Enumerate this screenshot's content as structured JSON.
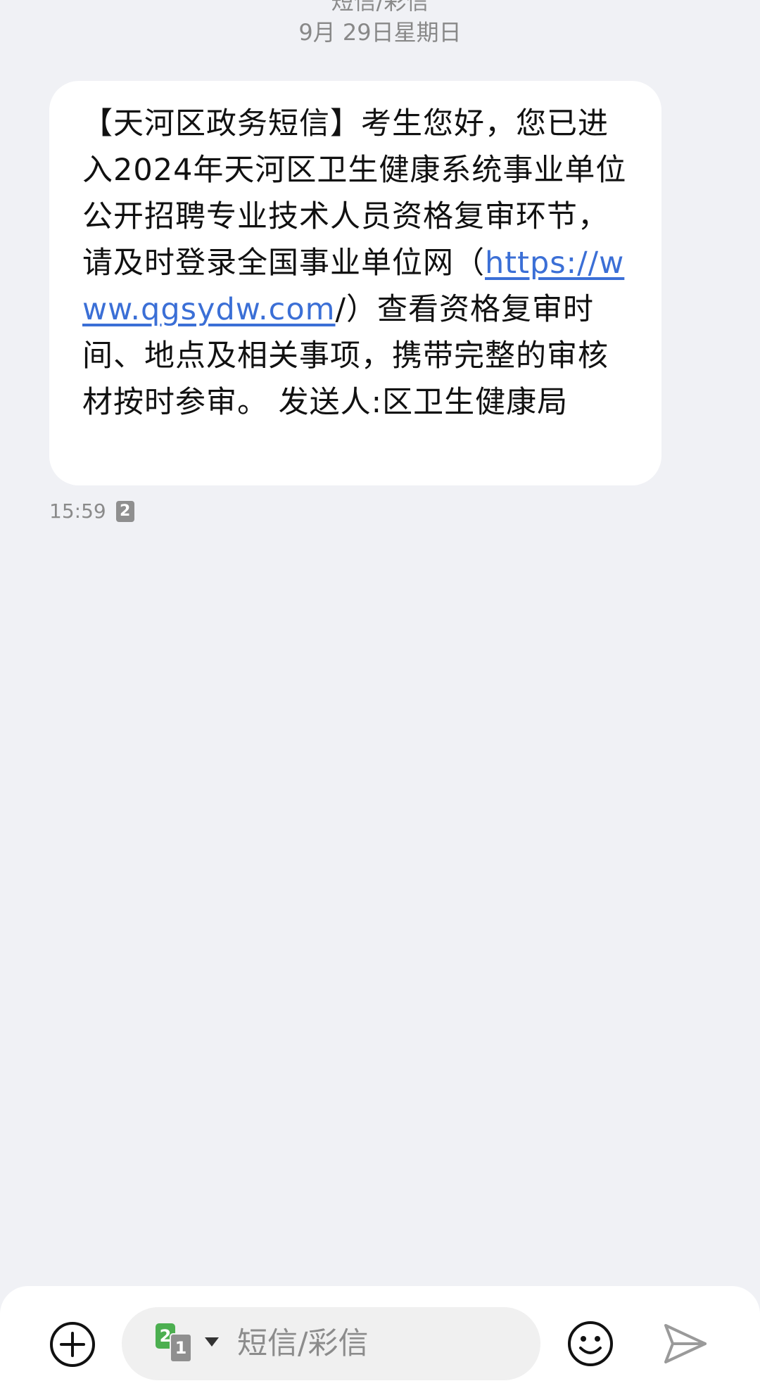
{
  "header": {
    "conversation_type": "短信/彩信",
    "date": "9月 29日星期日"
  },
  "message": {
    "text_prefix": "【天河区政务短信】考生您好，您已进入2024年天河区卫生健康系统事业单位公开招聘专业技术人员资格复审环节，请及时登录全国事业单位网（",
    "link": "https://www.qgsydw.com",
    "text_suffix": "/）查看资格复审时间、地点及相关事项，携带完整的审核材按时参审。 发送人:区卫生健康局",
    "time": "15:59",
    "sim": "2"
  },
  "composer": {
    "placeholder": "短信/彩信",
    "active_sim": "2",
    "secondary_sim": "1",
    "icons": {
      "add": "plus-circle-icon",
      "dropdown": "triangle-down-icon",
      "emoji": "smiley-icon",
      "send": "paper-plane-icon"
    }
  },
  "colors": {
    "background": "#f0f1f5",
    "bubble": "#ffffff",
    "link": "#3b6fd6",
    "sim_active": "#4caf50",
    "sim_inactive": "#8f8f8f"
  }
}
